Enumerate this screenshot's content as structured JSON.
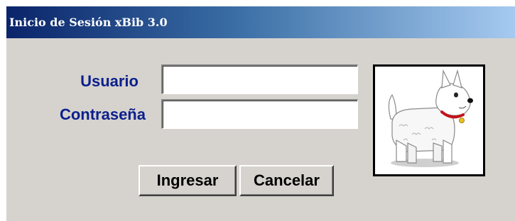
{
  "window": {
    "title": "Inicio de Sesión xBib 3.0"
  },
  "form": {
    "username_label": "Usuario",
    "password_label": "Contraseña",
    "username_value": "",
    "password_value": ""
  },
  "buttons": {
    "login_label": "Ingresar",
    "cancel_label": "Cancelar"
  },
  "picture": {
    "icon": "westie-dog-icon"
  },
  "colors": {
    "title_gradient_start": "#0a246a",
    "title_gradient_end": "#a6caf0",
    "label_color": "#0c1f8c",
    "window_background": "#d6d3ce"
  }
}
